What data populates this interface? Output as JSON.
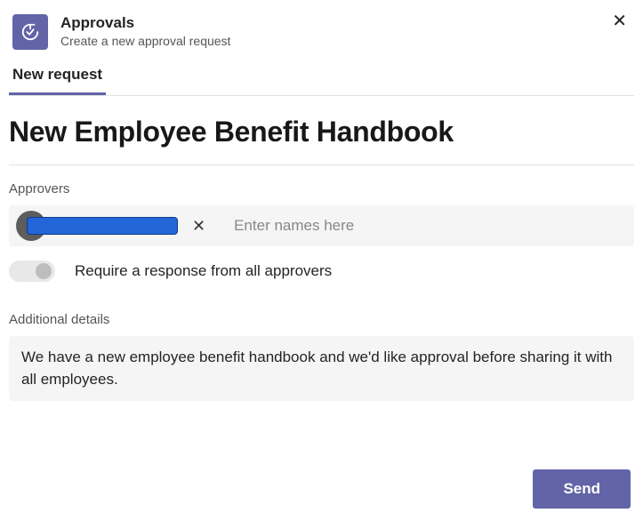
{
  "header": {
    "app_title": "Approvals",
    "app_subtitle": "Create a new approval request"
  },
  "tabs": {
    "new_request": "New request"
  },
  "request": {
    "title": "New Employee Benefit Handbook"
  },
  "approvers": {
    "label": "Approvers",
    "chip_name_redacted": "",
    "input_placeholder": "Enter names here",
    "toggle_label": "Require a response from all approvers",
    "toggle_on": false
  },
  "details": {
    "label": "Additional details",
    "value": "We have a new employee benefit handbook and we'd like approval before sharing it with all employees."
  },
  "actions": {
    "send": "Send"
  },
  "colors": {
    "brand": "#6264a7",
    "redaction_fill": "#2266d8"
  }
}
